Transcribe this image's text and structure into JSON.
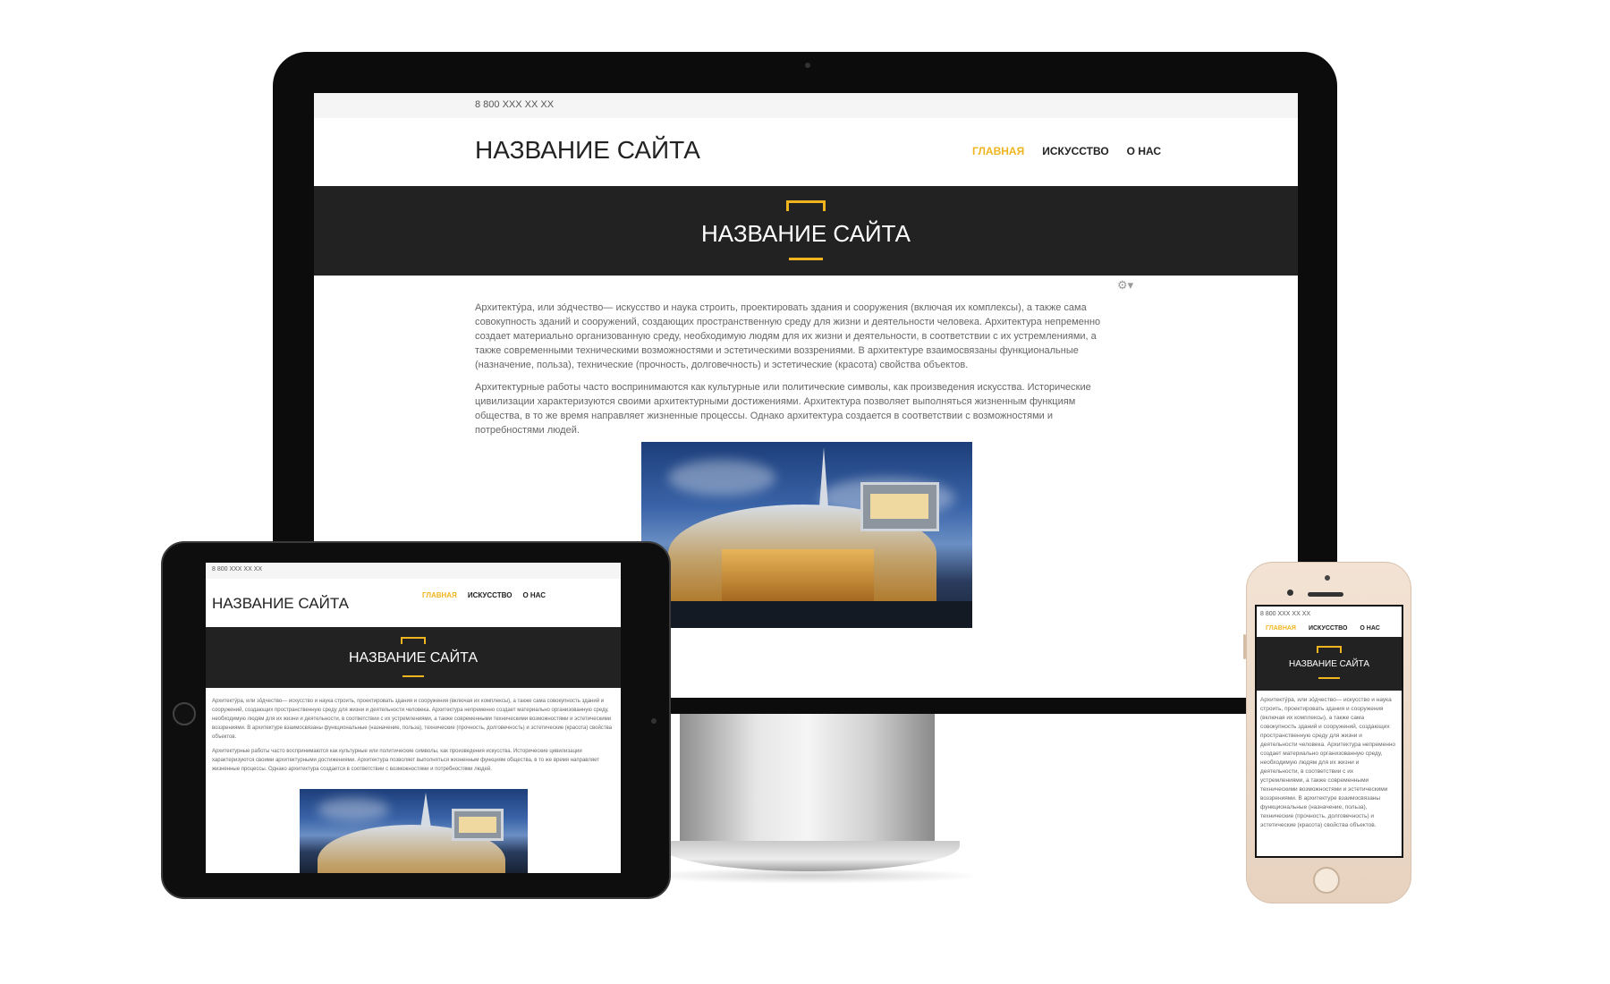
{
  "site": {
    "phone_number": "8 800 XXX XX XX",
    "site_name": "НАЗВАНИЕ САЙТА",
    "hero_title": "НАЗВАНИЕ САЙТА",
    "nav": [
      {
        "label": "ГЛАВНАЯ",
        "active": true
      },
      {
        "label": "ИСКУССТВО",
        "active": false
      },
      {
        "label": "О НАС",
        "active": false
      }
    ],
    "paragraph_1": "Архитекту́ра, или зо́дчество— искусство и наука строить, проектировать здания и сооружения (включая их комплексы), а также сама совокупность зданий и сооружений, создающих пространственную среду для жизни и деятельности человека. Архитектура непременно создает материально организованную среду, необходимую людям для их жизни и деятельности, в соответствии с их устремлениями, а также современными техническими возможностями и эстетическими воззрениями. В архитектуре взаимосвязаны функциональные (назначение, польза), технические (прочность, долговечность) и эстетические (красота) свойства объектов.",
    "paragraph_2": "Архитектурные работы часто воспринимаются как культурные или политические символы, как произведения искусства. Исторические цивилизации характеризуются своими архитектурными достижениями. Архитектура позволяет выполняться жизненным функциям общества, в то же время направляет жизненные процессы. Однако архитектура создается в соответствии с возможностями и потребностями людей.",
    "settings_icon": "gear-icon",
    "photo_subject": "modern-building-photo"
  },
  "colors": {
    "accent": "#f0b41e",
    "hero_bg": "#222222",
    "text": "#666666",
    "title": "#222222"
  }
}
